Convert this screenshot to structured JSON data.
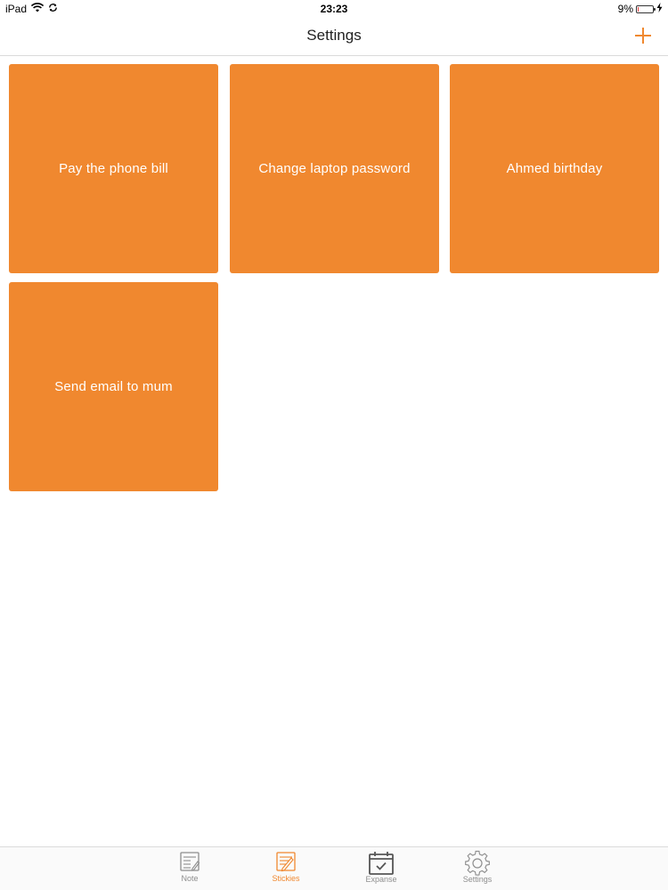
{
  "status_bar": {
    "device": "iPad",
    "time": "23:23",
    "battery": "9%",
    "battery_level": 0.09
  },
  "nav": {
    "title": "Settings",
    "add_icon": "plus-icon"
  },
  "stickies": [
    {
      "text": "Pay the phone bill"
    },
    {
      "text": "Change laptop password"
    },
    {
      "text": "Ahmed birthday"
    },
    {
      "text": "Send email to mum"
    }
  ],
  "tabs": [
    {
      "label": "Note",
      "icon": "note-icon",
      "active": false
    },
    {
      "label": "Stickies",
      "icon": "stickies-icon",
      "active": true
    },
    {
      "label": "Expanse",
      "icon": "calendar-check-icon",
      "active": false
    },
    {
      "label": "Settings",
      "icon": "gear-icon",
      "active": false
    }
  ],
  "colors": {
    "accent": "#F0882F",
    "sticky_bg": "#F0882F",
    "tab_inactive": "#8e8e8e"
  }
}
